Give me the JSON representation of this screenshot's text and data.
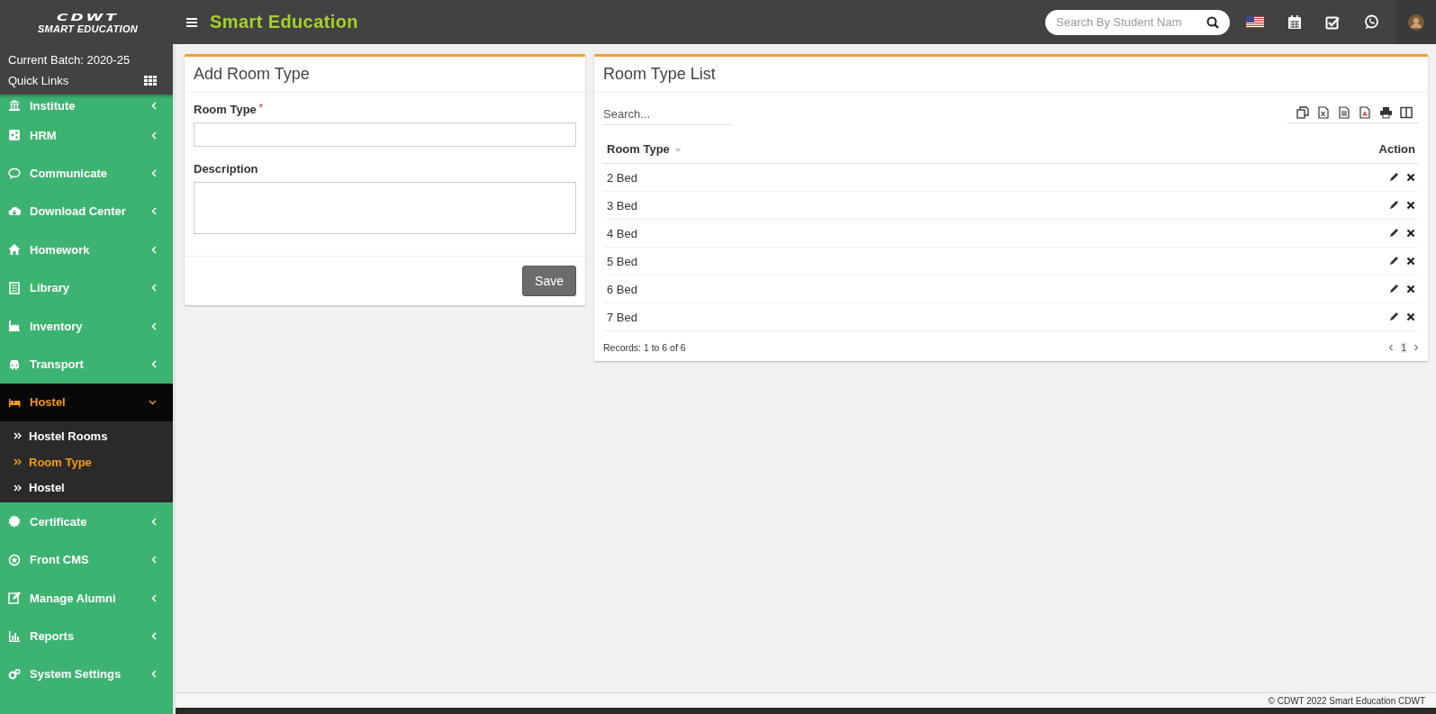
{
  "logo": {
    "brand": "CDWT",
    "tagline": "SMART EDUCATION"
  },
  "header": {
    "title": "Smart Education",
    "search": {
      "placeholder": "Search By Student Nam"
    }
  },
  "sidebar": {
    "batch": "Current Batch: 2020-25",
    "quick_links": "Quick Links",
    "items": [
      {
        "label": "Institute",
        "expanded": false,
        "selected": false
      },
      {
        "label": "HRM",
        "expanded": false,
        "selected": false
      },
      {
        "label": "Communicate",
        "expanded": false,
        "selected": false
      },
      {
        "label": "Download Center",
        "expanded": false,
        "selected": false
      },
      {
        "label": "Homework",
        "expanded": false,
        "selected": false
      },
      {
        "label": "Library",
        "expanded": false,
        "selected": false
      },
      {
        "label": "Inventory",
        "expanded": false,
        "selected": false
      },
      {
        "label": "Transport",
        "expanded": false,
        "selected": false
      },
      {
        "label": "Hostel",
        "expanded": true,
        "selected": true,
        "children": [
          {
            "label": "Hostel Rooms",
            "selected": false
          },
          {
            "label": "Room Type",
            "selected": true
          },
          {
            "label": "Hostel",
            "selected": false
          }
        ]
      },
      {
        "label": "Certificate",
        "expanded": false,
        "selected": false
      },
      {
        "label": "Front CMS",
        "expanded": false,
        "selected": false
      },
      {
        "label": "Manage Alumni",
        "expanded": false,
        "selected": false
      },
      {
        "label": "Reports",
        "expanded": false,
        "selected": false
      },
      {
        "label": "System Settings",
        "expanded": false,
        "selected": false
      }
    ]
  },
  "add_form": {
    "title": "Add Room Type",
    "fields": [
      {
        "label": "Room Type",
        "required_mark": "*",
        "kind": "input"
      },
      {
        "label": "Description",
        "kind": "textarea"
      }
    ],
    "save_button": "Save"
  },
  "list": {
    "title": "Room Type List",
    "search": {
      "placeholder": "Search..."
    },
    "columns": [
      "Room Type",
      "Action"
    ],
    "rows": [
      {
        "room_type": "2 Bed"
      },
      {
        "room_type": "3 Bed"
      },
      {
        "room_type": "4 Bed"
      },
      {
        "room_type": "5 Bed"
      },
      {
        "room_type": "6 Bed"
      },
      {
        "room_type": "7 Bed"
      }
    ],
    "records": "Records: 1 to 6 of 6",
    "pages": [
      {
        "label": "1",
        "selected": true
      }
    ]
  },
  "footer": "© CDWT 2022 Smart Education CDWT"
}
